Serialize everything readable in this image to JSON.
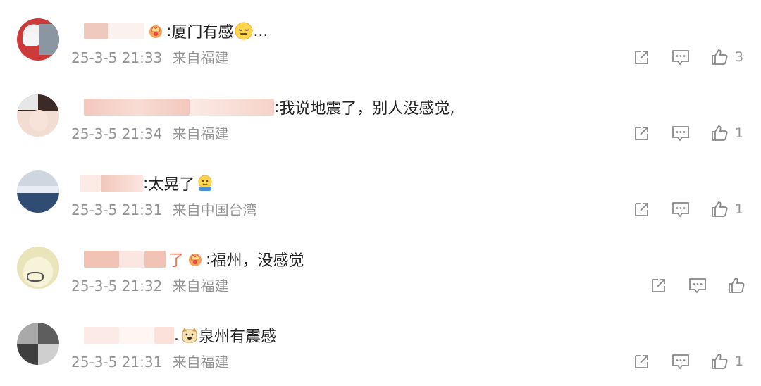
{
  "comments": [
    {
      "author_visible_suffix": "",
      "separator": ":",
      "text": "厦门有感",
      "trailing": "...",
      "emoji": "relieved-face",
      "has_badge": true,
      "time": "25-3-5 21:33",
      "location": "来自福建",
      "likes": "3"
    },
    {
      "author_visible_suffix": "",
      "separator": ":",
      "text": "我说地震了，别人没感觉,",
      "trailing": "",
      "emoji": "",
      "has_badge": false,
      "time": "25-3-5 21:34",
      "location": "来自福建",
      "likes": "1"
    },
    {
      "author_visible_suffix": "",
      "separator": ":",
      "text": "太晃了",
      "trailing": "",
      "emoji": "shaking-face",
      "has_badge": false,
      "time": "25-3-5 21:31",
      "location": "来自中国台湾",
      "likes": "1"
    },
    {
      "author_visible_suffix": "了",
      "separator": ":",
      "text": "福州，没感觉",
      "trailing": "",
      "emoji": "",
      "has_badge": true,
      "time": "25-3-5 21:32",
      "location": "来自福建",
      "likes": ""
    },
    {
      "author_visible_suffix": "",
      "separator": ".",
      "text": "泉州有震感",
      "trailing": "",
      "emoji": "dog-face",
      "has_badge": false,
      "time": "25-3-5 21:31",
      "location": "来自福建",
      "likes": "1"
    }
  ],
  "icons": {
    "share": "share-icon",
    "comment": "comment-icon",
    "like": "thumbs-up-icon",
    "badge": "vip-crown-badge-icon"
  },
  "colors": {
    "author_name": "#eb7350",
    "meta_text": "#939393",
    "body_text": "#222222",
    "icon_stroke": "#888888"
  }
}
